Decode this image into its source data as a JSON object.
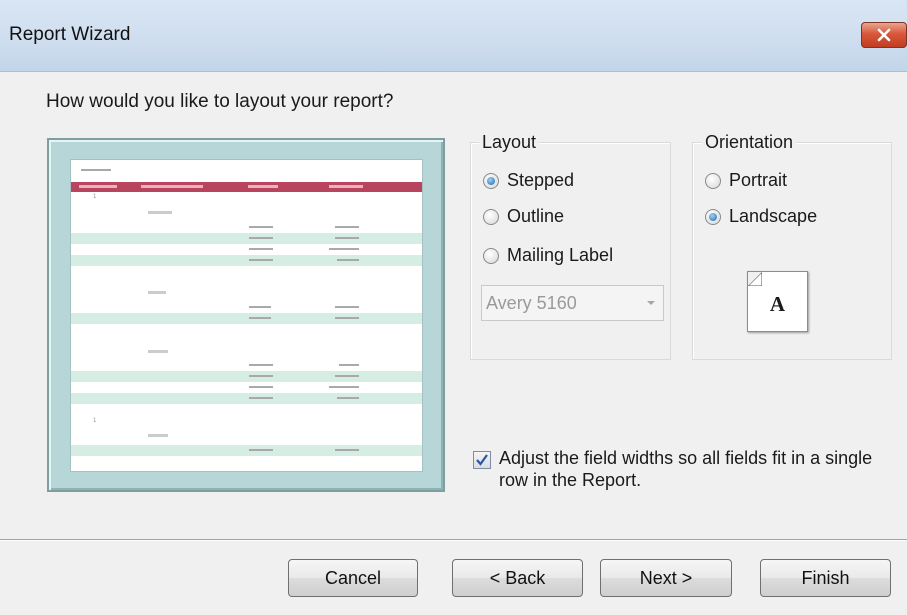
{
  "window": {
    "title": "Report Wizard"
  },
  "wizard": {
    "question": "How would you like to layout your report?",
    "layout_group": {
      "label": "Layout",
      "options": [
        {
          "label": "Stepped",
          "selected": true
        },
        {
          "label": "Outline",
          "selected": false
        },
        {
          "label": "Mailing Label",
          "selected": false
        }
      ],
      "label_type": {
        "value": "Avery 5160",
        "enabled": false
      }
    },
    "orientation_group": {
      "label": "Orientation",
      "options": [
        {
          "label": "Portrait",
          "selected": false
        },
        {
          "label": "Landscape",
          "selected": true
        }
      ],
      "preview_glyph": "A"
    },
    "adjust_widths": {
      "checked": true,
      "label": "Adjust the field widths so all fields fit in a single row in the Report."
    }
  },
  "buttons": {
    "cancel": "Cancel",
    "back": "< Back",
    "next": "Next >",
    "finish": "Finish"
  },
  "colors": {
    "preview_header": "#b8445e",
    "preview_band": "#d5ede3",
    "preview_frame": "#b6d6d8",
    "radio_selected": "#1f66b5",
    "close_button": "#d8573b"
  },
  "icons": {
    "close": "close-icon",
    "dropdown": "chevron-down-icon",
    "orientation": "page-orientation-icon",
    "check": "checkmark-icon"
  }
}
